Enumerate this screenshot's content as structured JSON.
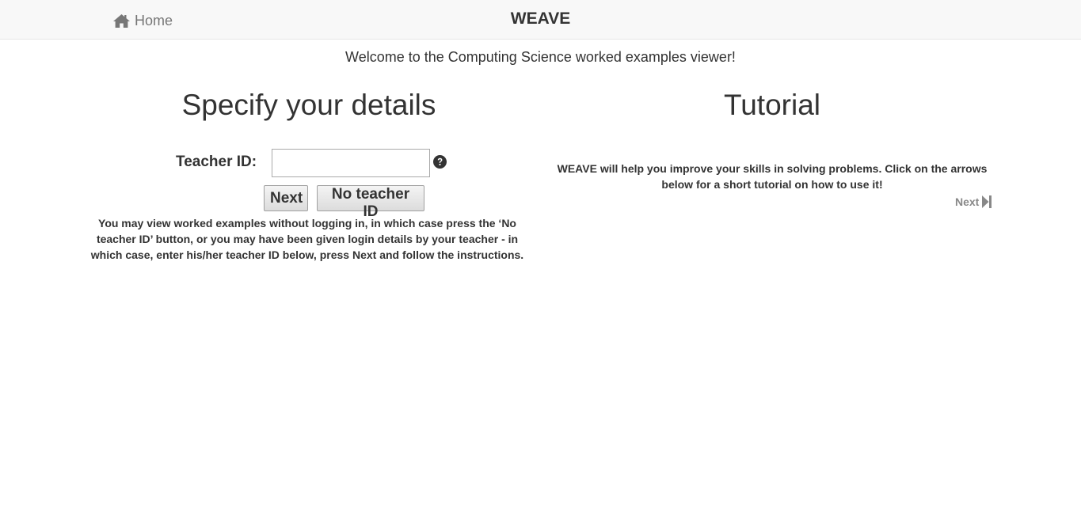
{
  "navbar": {
    "home_label": "Home",
    "home_icon": "home-icon",
    "brand": "WEAVE",
    "background": "#f8f8f8"
  },
  "welcome_text": "Welcome to the Computing Science worked examples viewer!",
  "details": {
    "heading": "Specify your details",
    "teacher_id_label": "Teacher ID:",
    "teacher_id_value": "",
    "help_icon": "question-circle-icon",
    "next_button": "Next",
    "no_teacher_button": "No teacher ID",
    "instructions": "You may view worked examples without logging in, in which case press the ‘No teacher ID’ button, or you may have been given login details by your teacher - in which case, enter his/her teacher ID below, press Next and follow the instructions."
  },
  "tutorial": {
    "heading": "Tutorial",
    "text": "WEAVE will help you improve your skills in solving problems. Click on the arrows below for a short tutorial on how to use it!",
    "next_label": "Next",
    "next_icon": "step-forward-icon",
    "next_color": "#888888"
  }
}
